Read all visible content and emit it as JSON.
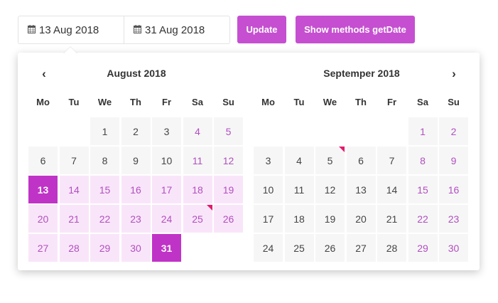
{
  "inputs": {
    "start": "13 Aug 2018",
    "end": "31 Aug 2018"
  },
  "buttons": {
    "update": "Update",
    "show_methods": "Show methods getDate"
  },
  "nav": {
    "prev": "‹",
    "next": "›"
  },
  "weekdays": [
    "Mo",
    "Tu",
    "We",
    "Th",
    "Fr",
    "Sa",
    "Su"
  ],
  "colors": {
    "accent": "#c54fd0",
    "selected": "#c033c7",
    "range_bg": "#f9e5f9",
    "weekend_text": "#b14fc0",
    "flag": "#e31a6e"
  },
  "calendars": [
    {
      "title": "August 2018",
      "first_weekday": 2,
      "days_in_month": 31,
      "range_start": 13,
      "range_end": 31,
      "flagged": [
        25
      ]
    },
    {
      "title": "Septemper 2018",
      "first_weekday": 5,
      "days_in_month": 30,
      "range_start": null,
      "range_end": null,
      "flagged": [
        5
      ]
    }
  ]
}
